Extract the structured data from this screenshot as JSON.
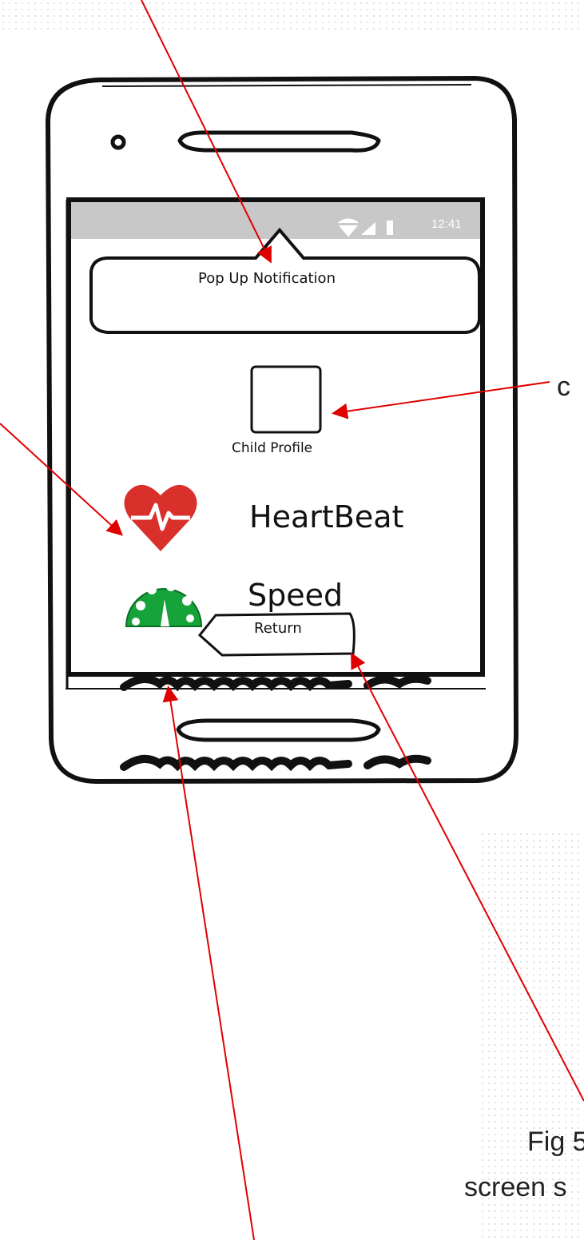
{
  "status_bar": {
    "time": "12:41"
  },
  "popup": {
    "text": "Pop Up Notification"
  },
  "child_profile": {
    "label": "Child Profile"
  },
  "metrics": [
    {
      "label": "HeartBeat",
      "icon": "heart-pulse-icon",
      "color": "#d9302c"
    },
    {
      "label": "Speed",
      "icon": "speedometer-icon",
      "color": "#16a33a"
    }
  ],
  "return_button": {
    "label": "Return"
  },
  "captions": {
    "right_top": "c",
    "bottom_fig": "Fig 5",
    "bottom_screen": "screen s"
  },
  "colors": {
    "annotation_arrow": "#e00000",
    "status_bar": "#c8c8c8",
    "outline": "#111111"
  }
}
